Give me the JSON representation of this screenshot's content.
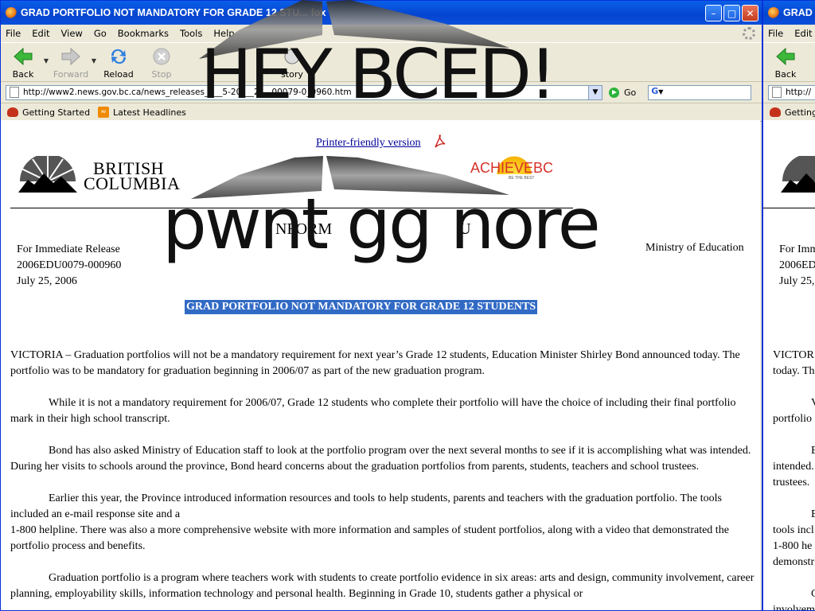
{
  "window": {
    "title": "GRAD PORTFOLIO NOT MANDATORY FOR GRADE 12 STU...",
    "title_suffix": "fox",
    "second_title": "GRAD P"
  },
  "menubar": [
    "File",
    "Edit",
    "View",
    "Go",
    "Bookmarks",
    "Tools",
    "Help"
  ],
  "second_menubar": [
    "File",
    "Edit"
  ],
  "toolbar": {
    "back": "Back",
    "forward": "Forward",
    "reload": "Reload",
    "stop": "Stop",
    "history": "story"
  },
  "url": "http://www2.news.gov.bc.ca/news_releases_2005-2009/2006EDU0079-000960.htm",
  "url_visible": "http://www2.news.gov.bc.ca/news_releases_2__5-20___2___00079-0_0960.htm",
  "second_url": "http://",
  "go_label": "Go",
  "bookmarks": [
    "Getting Started",
    "Latest Headlines"
  ],
  "second_bookmarks": [
    "Getting"
  ],
  "page": {
    "printer_link": "Printer-friendly version",
    "bc_logo_line1": "BRITISH",
    "bc_logo_line2": "COLUMBIA",
    "achieve_logo": "ACHIEVEBC",
    "achieve_tagline": "BE THE BEST",
    "info_heading": "NFORM",
    "info_heading_tail": "U",
    "release_type": "For Immediate Release",
    "release_id": "2006EDU0079-000960",
    "release_date": "July 25, 2006",
    "ministry": "Ministry of Education",
    "headline": "GRAD PORTFOLIO NOT MANDATORY FOR GRADE 12 STUDENTS",
    "p1": "VICTORIA – Graduation portfolios will not be a mandatory requirement for next year’s Grade 12 students, Education Minister Shirley Bond announced today. The portfolio was to be mandatory for graduation beginning in 2006/07 as part of the new graduation program.",
    "p2": "While it is not a mandatory requirement for 2006/07, Grade 12 students who complete their portfolio will have the choice of including their final portfolio mark in their high school transcript.",
    "p3": "Bond has also asked Ministry of Education staff to look at the portfolio program over the next several months to see if it is accomplishing what was intended. During her visits to schools around the province, Bond heard concerns about the graduation portfolios from parents, students, teachers and school trustees.",
    "p4a": "Earlier this year, the Province introduced information resources and tools to help students, parents and teachers with the graduation portfolio. The tools included an e-mail response site and a",
    "p4b": "1-800 helpline. There was also a more comprehensive website with more information and samples of student portfolios, along with a video that demonstrated the portfolio process and benefits.",
    "p5": "Graduation portfolio is a program where teachers work with students to create portfolio evidence in six areas: arts and design, community involvement, career planning, employability skills, information technology and personal health. Beginning in Grade 10, students gather a physical or"
  },
  "second_page": {
    "l1": "For Imm",
    "l2": "2006ED",
    "l3": "July 25,",
    "l4": "VICTOR",
    "l5": "today. Th",
    "l6": "V",
    "l7": "portfolio",
    "l8": "B",
    "l9": "intended.",
    "l10": "trustees.",
    "l11": "E",
    "l12": "tools incl",
    "l13": "1-800 he",
    "l14": "demonstr",
    "l15": "C",
    "l16": "involvem"
  },
  "overlay": {
    "line1": "HEY BCED!",
    "line2": "pwnt gg nore"
  }
}
